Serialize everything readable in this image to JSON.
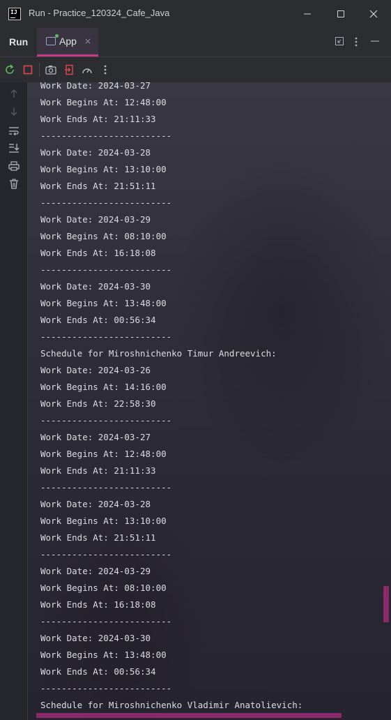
{
  "window": {
    "title": "Run - Practice_120324_Cafe_Java",
    "logo_text": "IJ",
    "accent_color": "#c93b8b"
  },
  "tool_window": {
    "name": "Run",
    "tab_label": "App",
    "tab_close": "×"
  },
  "icons": {
    "minimize": "minimize-icon",
    "maximize": "maximize-icon",
    "close": "close-icon",
    "rerun": "rerun-icon",
    "stop": "stop-icon",
    "screenshot": "camera-icon",
    "exit": "exit-icon",
    "profiler": "speedometer-icon",
    "more": "more-vertical-icon",
    "up": "arrow-up-icon",
    "down": "arrow-down-icon",
    "soft_wrap": "soft-wrap-icon",
    "scroll_end": "scroll-to-end-icon",
    "print": "print-icon",
    "clear": "trash-icon"
  },
  "console": {
    "lines": [
      "Work Date: 2024-03-27",
      "Work Begins At: 12:48:00",
      "Work Ends At: 21:11:33",
      "-------------------------",
      "Work Date: 2024-03-28",
      "Work Begins At: 13:10:00",
      "Work Ends At: 21:51:11",
      "-------------------------",
      "Work Date: 2024-03-29",
      "Work Begins At: 08:10:00",
      "Work Ends At: 16:18:08",
      "-------------------------",
      "Work Date: 2024-03-30",
      "Work Begins At: 13:48:00",
      "Work Ends At: 00:56:34",
      "-------------------------",
      "Schedule for Miroshnichenko Timur Andreevich:",
      "Work Date: 2024-03-26",
      "Work Begins At: 14:16:00",
      "Work Ends At: 22:58:30",
      "-------------------------",
      "Work Date: 2024-03-27",
      "Work Begins At: 12:48:00",
      "Work Ends At: 21:11:33",
      "-------------------------",
      "Work Date: 2024-03-28",
      "Work Begins At: 13:10:00",
      "Work Ends At: 21:51:11",
      "-------------------------",
      "Work Date: 2024-03-29",
      "Work Begins At: 08:10:00",
      "Work Ends At: 16:18:08",
      "-------------------------",
      "Work Date: 2024-03-30",
      "Work Begins At: 13:48:00",
      "Work Ends At: 00:56:34",
      "-------------------------",
      "Schedule for Miroshnichenko Vladimir Anatolievich:"
    ]
  }
}
